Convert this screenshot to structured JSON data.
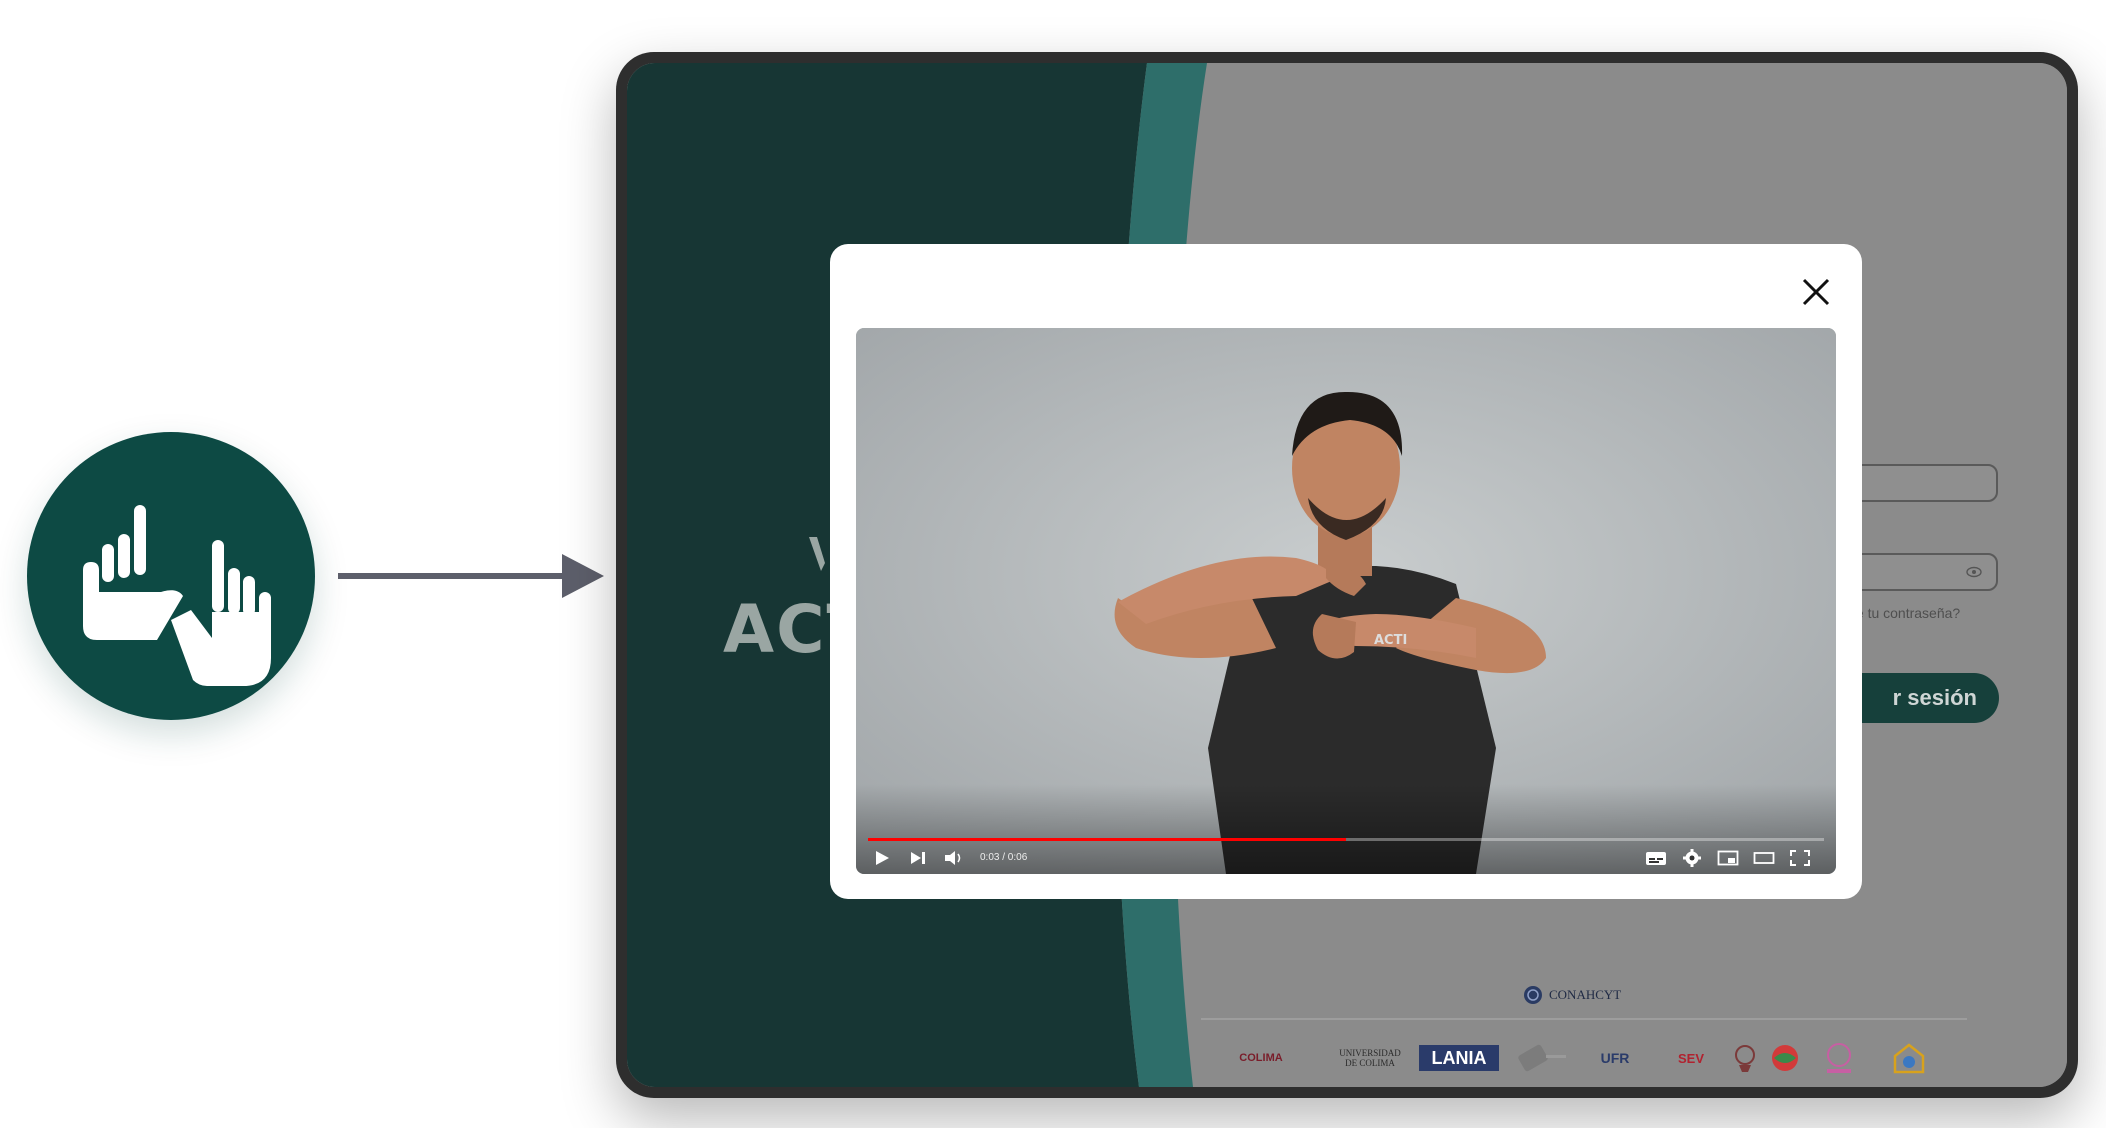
{
  "background_page": {
    "logo_text": "ACT",
    "forgot_password": "ste tu contraseña?",
    "login_button": "r sesión",
    "sponsor_heading": "CONAHCYT",
    "sponsors": [
      "COLIMA",
      "UNIVERSIDAD DE COLIMA",
      "LANIA",
      "",
      "UFR",
      "SEV",
      "",
      "",
      "",
      ""
    ]
  },
  "video_player": {
    "time_display": "0:03 / 0:06",
    "progress_fraction": 0.5,
    "shirt_text": "ACTI"
  },
  "icons": {
    "hand": "hand-pointing-icon",
    "arrow": "arrow-right-icon",
    "close": "close-icon",
    "play": "play-icon",
    "next": "next-icon",
    "volume": "volume-icon",
    "subtitles": "subtitles-icon",
    "settings": "gear-icon",
    "miniplayer": "miniplayer-icon",
    "theater": "theater-mode-icon",
    "fullscreen": "fullscreen-icon"
  },
  "colors": {
    "brand_dark": "#0d4a44",
    "teal_stripe": "#2e6e6a",
    "panel_dark": "#173634",
    "progress": "#ff0000"
  }
}
